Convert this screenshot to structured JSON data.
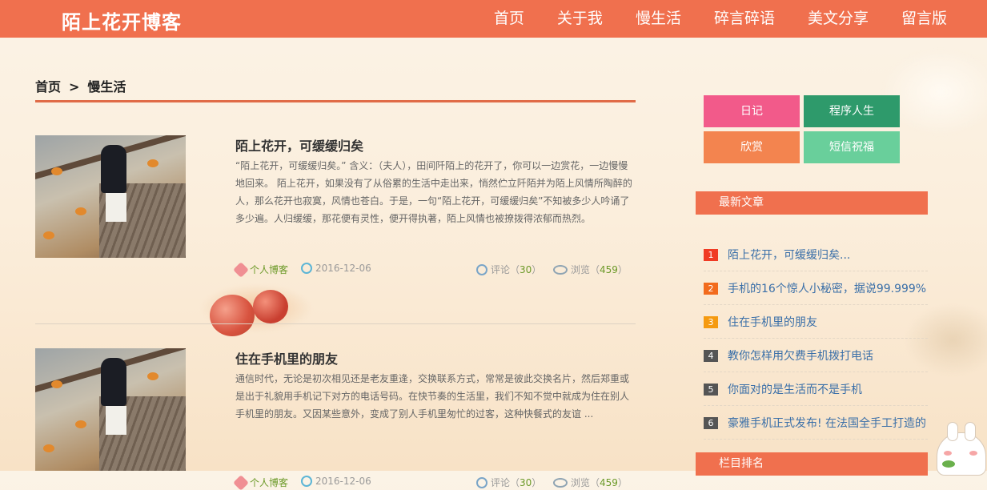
{
  "header": {
    "logo": "陌上花开博客",
    "nav": [
      "首页",
      "关于我",
      "慢生活",
      "碎言碎语",
      "美文分享",
      "留言版"
    ]
  },
  "breadcrumb": {
    "home": "首页",
    "sep": ">",
    "current": "慢生活"
  },
  "articles": [
    {
      "title": "陌上花开，可缓缓归矣",
      "desc": "“陌上花开，可缓缓归矣。” 含义：（夫人），田间阡陌上的花开了，你可以一边赏花，一边慢慢地回来。 陌上花开，如果没有了从俗累的生活中走出来，悄然伫立阡陌并为陌上风情所陶醉的人，那么花开也寂寞，风情也苍白。于是，一句“陌上花开，可缓缓归矣”不知被多少人吟诵了多少遍。人归缓缓，那花便有灵性，便开得执著，陌上风情也被撩拨得浓郁而热烈。",
      "category": "个人博客",
      "date": "2016-12-06",
      "comments_label": "评论（",
      "comments": "30",
      "views_label": "浏览（",
      "views": "459",
      "close": "）"
    },
    {
      "title": "住在手机里的朋友",
      "desc": "通信时代，无论是初次相见还是老友重逢，交换联系方式，常常是彼此交换名片，然后郑重或是出于礼貌用手机记下对方的电话号码。在快节奏的生活里，我们不知不觉中就成为住在别人手机里的朋友。又因某些意外，变成了别人手机里匆忙的过客，这种快餐式的友谊 ...",
      "category": "个人博客",
      "date": "2016-12-06",
      "comments_label": "评论（",
      "comments": "30",
      "views_label": "浏览（",
      "views": "459",
      "close": "）"
    }
  ],
  "sidebar": {
    "tags": [
      {
        "label": "日记",
        "color": "#f25a8a"
      },
      {
        "label": "程序人生",
        "color": "#2e9a6b"
      },
      {
        "label": "欣赏",
        "color": "#f3844f"
      },
      {
        "label": "短信祝福",
        "color": "#69cf9b"
      }
    ],
    "latest_title": "最新文章",
    "latest": [
      {
        "num": "1",
        "title": "陌上花开，可缓缓归矣...",
        "color": "#f03b24"
      },
      {
        "num": "2",
        "title": "手机的16个惊人小秘密，据说99.999%",
        "color": "#f26b1d"
      },
      {
        "num": "3",
        "title": "住在手机里的朋友",
        "color": "#f59a10"
      },
      {
        "num": "4",
        "title": "教你怎样用欠费手机拨打电话",
        "color": "#555555"
      },
      {
        "num": "5",
        "title": "你面对的是生活而不是手机",
        "color": "#555555"
      },
      {
        "num": "6",
        "title": "豪雅手机正式发布! 在法国全手工打造的",
        "color": "#555555"
      }
    ],
    "ranking_title": "栏目排名"
  }
}
